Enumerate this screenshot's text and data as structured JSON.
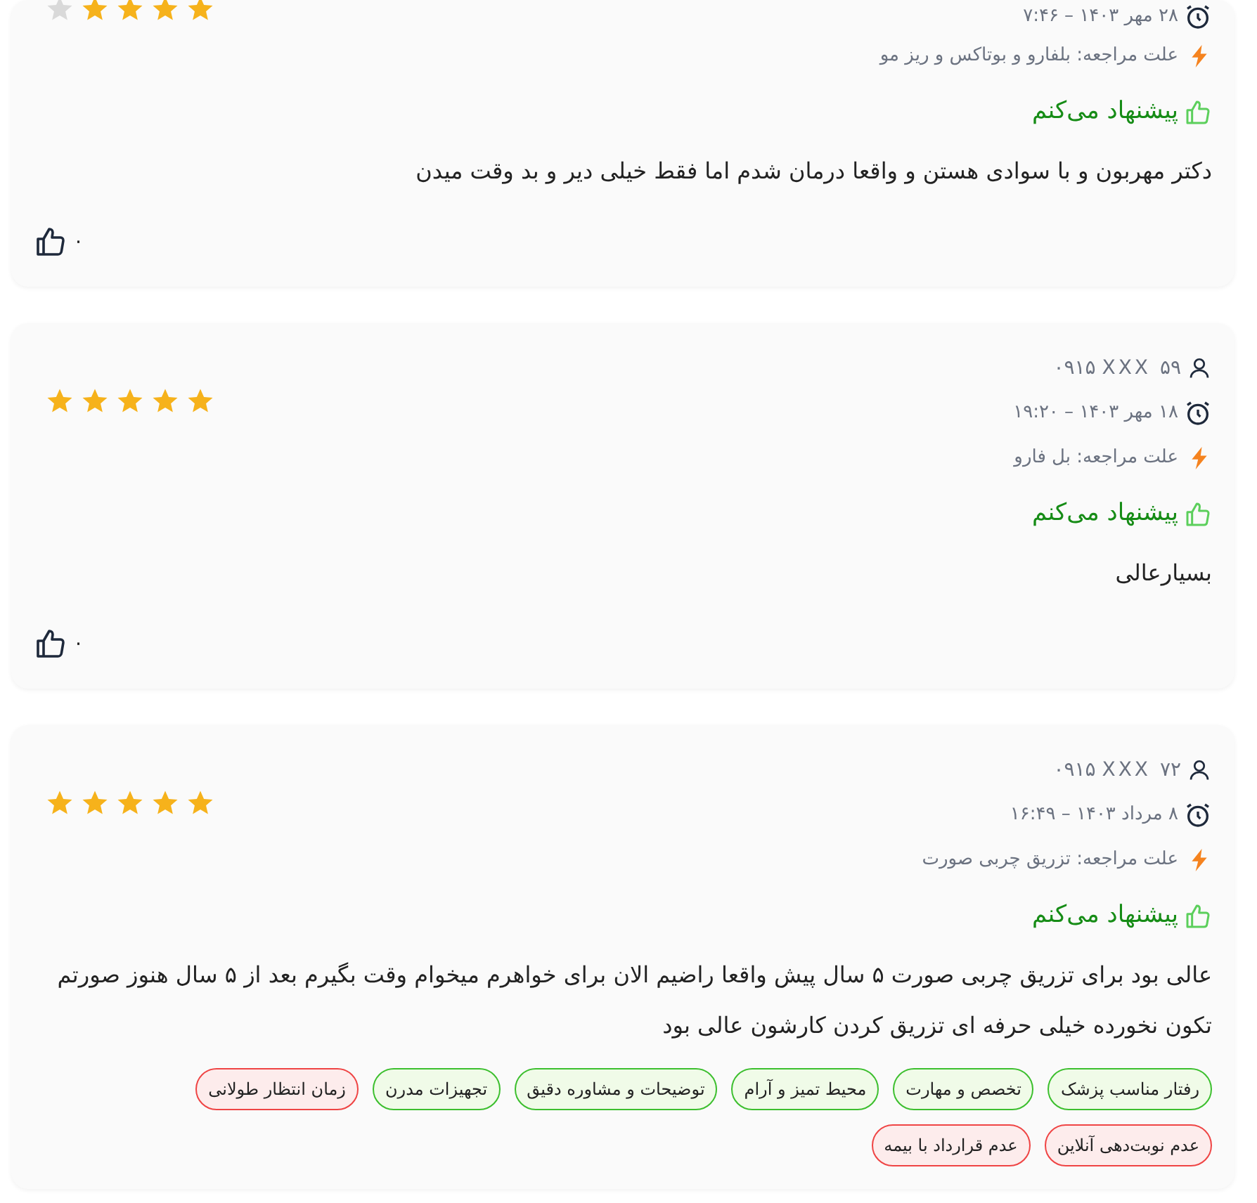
{
  "reviews": [
    {
      "stars": 4,
      "date": "۲۸ مهر ۱۴۰۳ – ۷:۴۶",
      "reason": "علت مراجعه: بلفارو و بوتاکس و ریز مو",
      "recommend": {
        "text": "پیشنهاد می‌کنم",
        "recommended": true
      },
      "text": "دکتر مهربون و با سوادی هستن و واقعا درمان شدم اما فقط خیلی دیر و بد وقت میدن",
      "likes": "۰"
    },
    {
      "user": "۰۹۱۵ XXX ۵۹",
      "stars": 5,
      "date": "۱۸ مهر ۱۴۰۳ – ۱۹:۲۰",
      "reason": "علت مراجعه: بل فارو",
      "recommend": {
        "text": "پیشنهاد می‌کنم",
        "recommended": true
      },
      "text": "بسیارعالی",
      "likes": "۰"
    },
    {
      "user": "۰۹۱۵ XXX ۷۲",
      "stars": 5,
      "date": "۸ مرداد ۱۴۰۳ – ۱۶:۴۹",
      "reason": "علت مراجعه: تزریق چربی صورت",
      "recommend": {
        "text": "پیشنهاد می‌کنم",
        "recommended": true
      },
      "text": "عالی بود برای تزریق چربی صورت ۵ سال پیش واقعا راضیم الان برای خواهرم میخوام وقت بگیرم بعد از ۵ سال هنوز صورتم تکون نخورده خیلی حرفه ای تزریق کردن کارشون عالی بود",
      "tags": [
        {
          "label": "رفتار مناسب پزشک",
          "kind": "positive"
        },
        {
          "label": "تخصص و مهارت",
          "kind": "positive"
        },
        {
          "label": "محیط تمیز و آرام",
          "kind": "positive"
        },
        {
          "label": "توضیحات و مشاوره دقیق",
          "kind": "positive"
        },
        {
          "label": "تجهیزات مدرن",
          "kind": "positive"
        },
        {
          "label": "زمان انتظار طولانی",
          "kind": "negative"
        },
        {
          "label": "عدم نوبت‌دهی آنلاین",
          "kind": "negative"
        },
        {
          "label": "عدم قرارداد با بیمه",
          "kind": "negative"
        }
      ]
    }
  ]
}
